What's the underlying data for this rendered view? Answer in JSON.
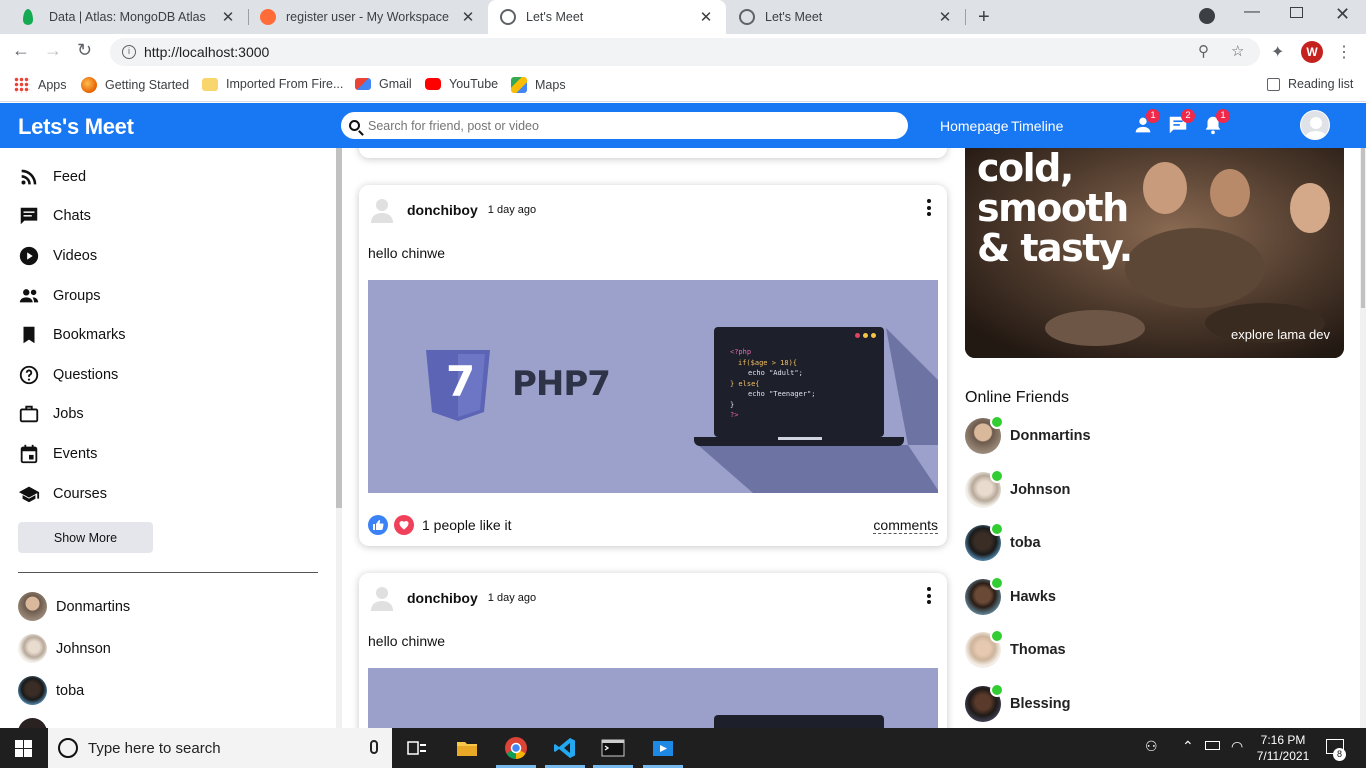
{
  "browser": {
    "tabs": [
      {
        "title": "Data | Atlas: MongoDB Atlas",
        "favicon_color": "#13aa52",
        "favicon": "mongodb-leaf-icon"
      },
      {
        "title": "register user - My Workspace",
        "favicon_color": "#ff6c37",
        "favicon": "postman-icon"
      },
      {
        "title": "Let's Meet",
        "favicon_color": "#5f6368",
        "favicon": "globe-icon",
        "active": true
      },
      {
        "title": "Let's Meet",
        "favicon_color": "#5f6368",
        "favicon": "globe-icon"
      }
    ],
    "url": "http://localhost:3000",
    "profile_initial": "W",
    "bookmarks": [
      {
        "label": "Apps",
        "icon": "apps-grid-icon"
      },
      {
        "label": "Getting Started",
        "icon": "firefox-icon"
      },
      {
        "label": "Imported From Fire...",
        "icon": "folder-icon"
      },
      {
        "label": "Gmail",
        "icon": "gmail-icon"
      },
      {
        "label": "YouTube",
        "icon": "youtube-icon"
      },
      {
        "label": "Maps",
        "icon": "maps-icon"
      }
    ],
    "reading_list": "Reading list"
  },
  "topbar": {
    "logo": "Lets's Meet",
    "search_placeholder": "Search for friend, post or video",
    "links": [
      "Homepage",
      "Timeline"
    ],
    "badges": {
      "friends": "1",
      "messages": "2",
      "notifications": "1"
    },
    "accent": "#1877f2"
  },
  "sidebar": {
    "items": [
      {
        "label": "Feed",
        "icon": "rss-feed-icon"
      },
      {
        "label": "Chats",
        "icon": "chat-icon"
      },
      {
        "label": "Videos",
        "icon": "play-circle-icon"
      },
      {
        "label": "Groups",
        "icon": "group-icon"
      },
      {
        "label": "Bookmarks",
        "icon": "bookmark-icon"
      },
      {
        "label": "Questions",
        "icon": "help-circle-icon"
      },
      {
        "label": "Jobs",
        "icon": "briefcase-icon"
      },
      {
        "label": "Events",
        "icon": "calendar-icon"
      },
      {
        "label": "Courses",
        "icon": "school-icon"
      }
    ],
    "show_more": "Show More",
    "friends": [
      "Donmartins",
      "Johnson",
      "toba"
    ]
  },
  "posts": [
    {
      "user": "donchiboy",
      "time": "1 day ago",
      "text": "hello chinwe",
      "image_caption": "PHP7",
      "image_badge": "7",
      "code_lines": [
        "<?php",
        "if($age > 18){",
        "echo \"Adult\";",
        "} else{",
        "echo \"Teenager\";",
        "}",
        "?>"
      ],
      "likes": "1 people like it",
      "comments": "comments"
    },
    {
      "user": "donchiboy",
      "time": "1 day ago",
      "text": "hello chinwe"
    }
  ],
  "rightbar": {
    "ad_lines": [
      "cold,",
      "smooth",
      "& tasty."
    ],
    "ad_small": "explore lama dev",
    "online_title": "Online Friends",
    "online_friends": [
      "Donmartins",
      "Johnson",
      "toba",
      "Hawks",
      "Thomas",
      "Blessing"
    ],
    "online_color": "#32cd32"
  },
  "taskbar": {
    "search_placeholder": "Type here to search",
    "time": "7:16 PM",
    "date": "7/11/2021",
    "notification_count": "8"
  }
}
